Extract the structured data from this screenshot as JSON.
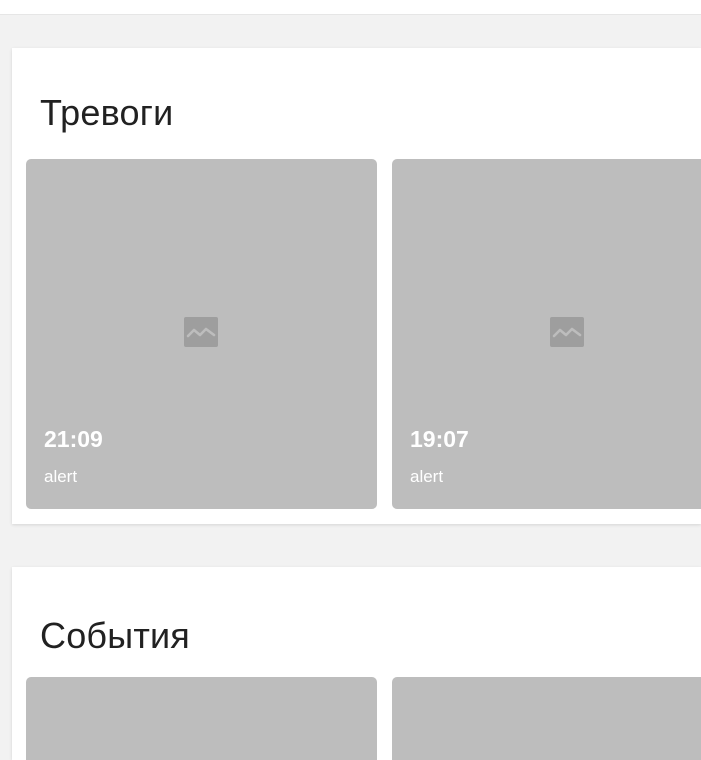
{
  "sections": [
    {
      "title": "Тревоги",
      "items": [
        {
          "time": "21:09",
          "type": "alert",
          "icon": "broken-image-icon"
        },
        {
          "time": "19:07",
          "type": "alert",
          "icon": "broken-image-icon"
        }
      ]
    },
    {
      "title": "События",
      "items": [
        {
          "time": "",
          "type": "",
          "icon": ""
        },
        {
          "time": "",
          "type": "",
          "icon": ""
        }
      ]
    }
  ],
  "colors": {
    "background": "#f2f2f2",
    "card": "#bdbdbd",
    "icon": "#9e9e9e",
    "title": "#212121"
  }
}
